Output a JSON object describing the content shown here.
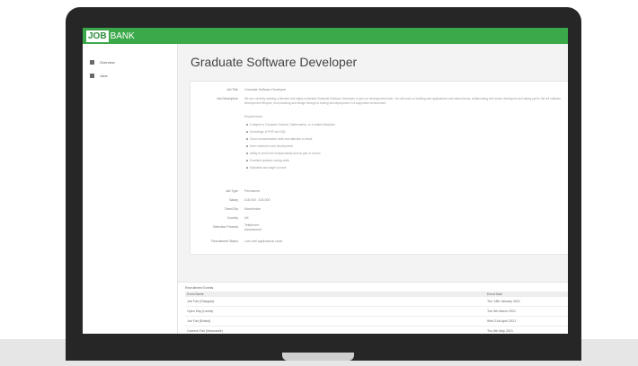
{
  "app": {
    "logo_box": "JOB",
    "logo_rest": "BANK"
  },
  "sidebar": {
    "items": [
      {
        "label": "Overview"
      },
      {
        "label": "Jobs"
      }
    ]
  },
  "page": {
    "title": "Graduate Software Developer"
  },
  "details": {
    "job_title_label": "Job Title",
    "job_title_value": "Graduate Software Developer",
    "description_label": "Job Description",
    "description_text": "We are currently seeking a talented and highly motivated Graduate Software Developer to join our development team. You will work on building web applications and internal tools, collaborating with senior developers and taking part in the full software development lifecycle, from planning and design through to testing and deployment in a supportive environment.",
    "requirements_heading": "Requirements:",
    "requirements": [
      "A degree in Computer Science, Mathematics, or a related discipline",
      "Knowledge of PHP and SQL",
      "Good communication skills and attention to detail",
      "Keen interest in web development",
      "Ability to work both independently and as part of a team",
      "Excellent problem solving skills",
      "Motivated and eager to learn"
    ],
    "job_type_label": "Job Type",
    "job_type_value": "Permanent",
    "salary_label": "Salary",
    "salary_value": "£18,000 - £24,000",
    "town_label": "Town/City",
    "town_value": "Manchester",
    "country_label": "Country",
    "country_value": "UK",
    "selection_label": "Selection Process",
    "selection_value_1": "Telephone",
    "selection_value_2": "Assessment",
    "recruitment_label": "Recruitment Status",
    "recruitment_value": "Live until applications close"
  },
  "table": {
    "title": "Recruitment Events",
    "columns": [
      "Event Name",
      "Event Date"
    ],
    "rows": [
      {
        "name": "Job Fair (Glasgow)",
        "date": "Thu 14th January 2021"
      },
      {
        "name": "Open Day (Leeds)",
        "date": "Tue 9th March 2021"
      },
      {
        "name": "Job Fair (Bristol)",
        "date": "Wed 21st April 2021"
      },
      {
        "name": "Careers Fair (Newcastle)",
        "date": "Thu 6th May 2021"
      }
    ]
  }
}
